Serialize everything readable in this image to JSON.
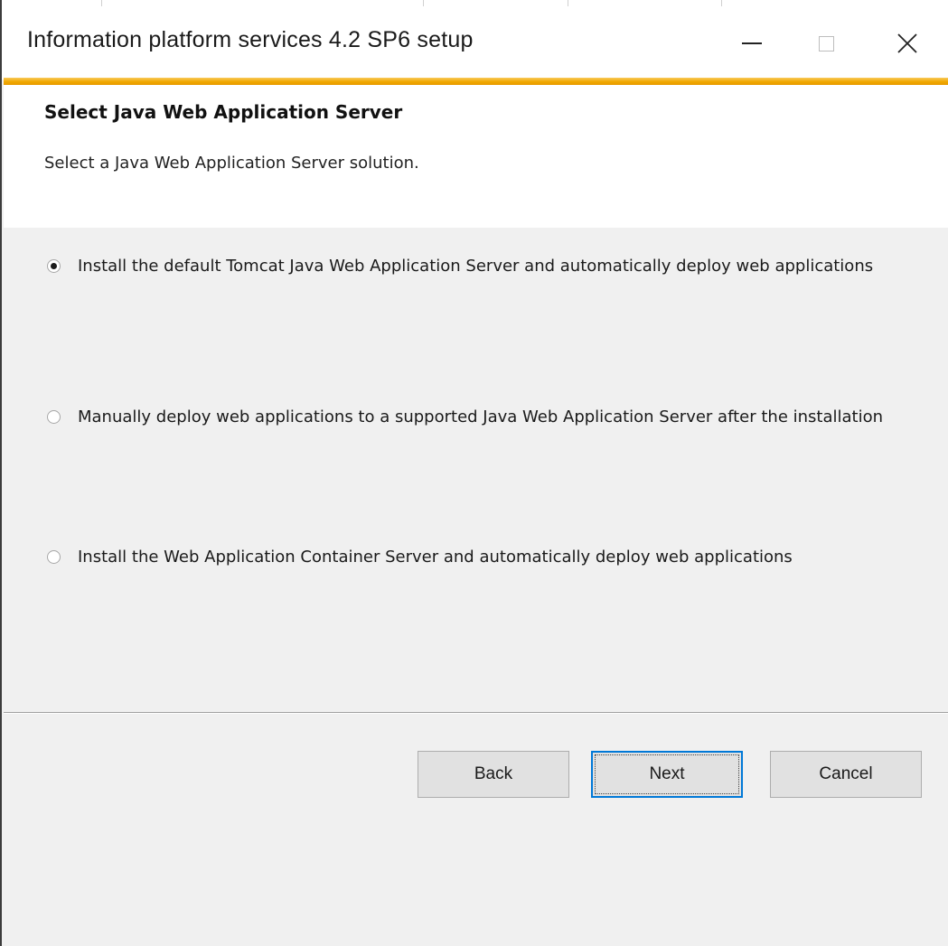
{
  "window": {
    "title": "Information platform services 4.2 SP6 setup",
    "controls": {
      "minimize_icon": "minimize-icon",
      "maximize_icon": "maximize-icon",
      "close_icon": "close-icon"
    },
    "accent_color": "#f0a800"
  },
  "header": {
    "title": "Select Java Web Application Server",
    "subtitle": "Select a Java Web Application Server solution."
  },
  "options": [
    {
      "label": "Install the default Tomcat Java Web Application Server and automatically deploy web applications",
      "selected": true
    },
    {
      "label": "Manually deploy web applications to a supported Java Web Application Server after the installation",
      "selected": false
    },
    {
      "label": "Install the Web Application Container Server and automatically deploy web applications",
      "selected": false
    }
  ],
  "footer": {
    "back_label": "Back",
    "next_label": "Next",
    "cancel_label": "Cancel",
    "default_button_color": "#0078d7"
  }
}
